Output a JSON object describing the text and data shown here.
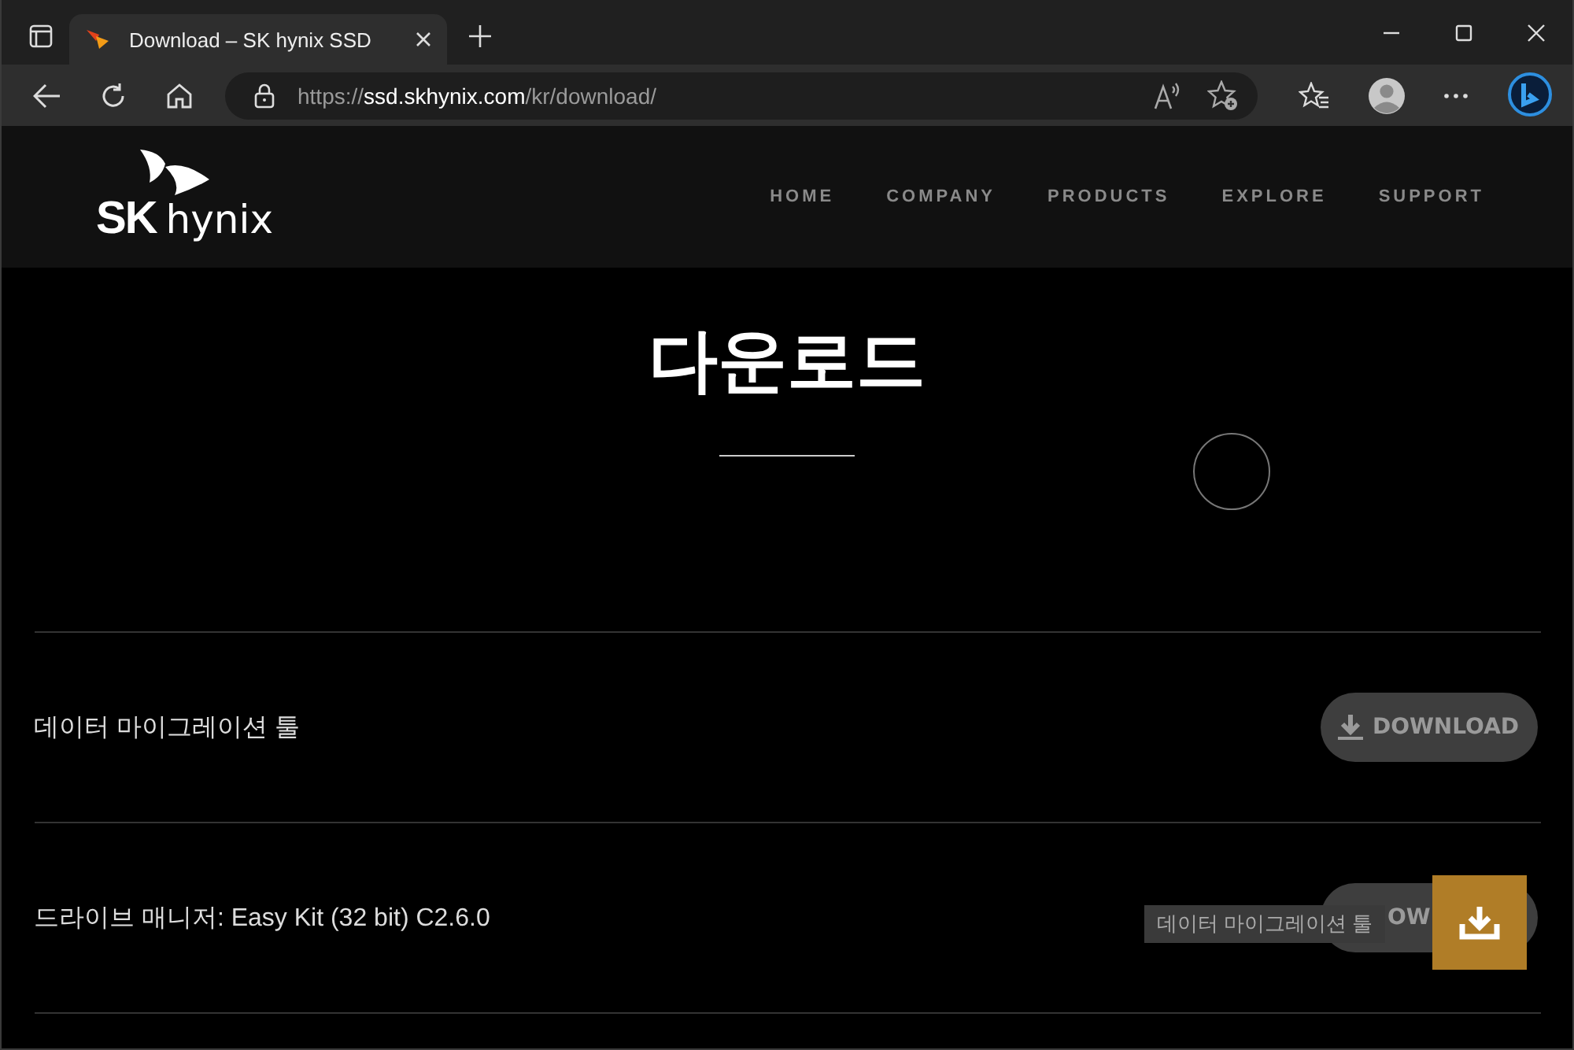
{
  "browser": {
    "tab": {
      "title": "Download – SK hynix SSD",
      "selected": true
    },
    "address": {
      "scheme": "https://",
      "host": "ssd.skhynix.com",
      "path": "/kr/download/"
    }
  },
  "site": {
    "logo": {
      "text_1": "SK",
      "text_2": "hynix"
    },
    "nav": [
      {
        "label": "HOME"
      },
      {
        "label": "COMPANY"
      },
      {
        "label": "PRODUCTS"
      },
      {
        "label": "EXPLORE"
      },
      {
        "label": "SUPPORT"
      }
    ]
  },
  "page": {
    "title": "다운로드"
  },
  "downloads": [
    {
      "name": "데이터 마이그레이션 툴",
      "button": "DOWNLOAD"
    },
    {
      "name": "드라이브 매니저: Easy Kit (32 bit) C2.6.0",
      "button": "OW"
    }
  ],
  "tooltip": "데이터 마이그레이션 툴"
}
